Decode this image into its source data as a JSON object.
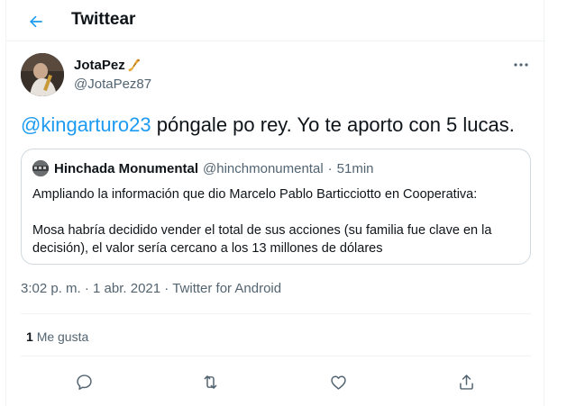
{
  "header": {
    "title": "Twittear",
    "back_icon": "back-arrow-icon"
  },
  "author": {
    "name": "JotaPez",
    "name_emoji": "saxophone-icon",
    "handle": "@JotaPez87"
  },
  "tweet": {
    "mention": "@kingarturo23",
    "text": " póngale po rey. Yo te aporto con 5 lucas."
  },
  "quote": {
    "name": "Hinchada Monumental",
    "handle": "@hinchmonumental",
    "separator": "·",
    "time": "51min",
    "line1": "Ampliando la información que dio Marcelo Pablo Barticciotto en Cooperativa:",
    "line2": "Mosa habría decidido vender el total de sus acciones (su familia fue clave en la decisión), el valor sería cercano a los 13 millones de dólares"
  },
  "meta": {
    "time": "3:02 p. m.",
    "sep": "·",
    "date": "1 abr. 2021",
    "source": "Twitter for Android"
  },
  "likes": {
    "count": "1",
    "label": "Me gusta"
  },
  "actions": [
    "reply-icon",
    "retweet-icon",
    "like-icon",
    "share-icon"
  ],
  "colors": {
    "accent": "#1d9bf0",
    "text": "#0f1419",
    "secondary": "#536471",
    "border": "#cfd9de",
    "divider": "#eff3f4"
  }
}
